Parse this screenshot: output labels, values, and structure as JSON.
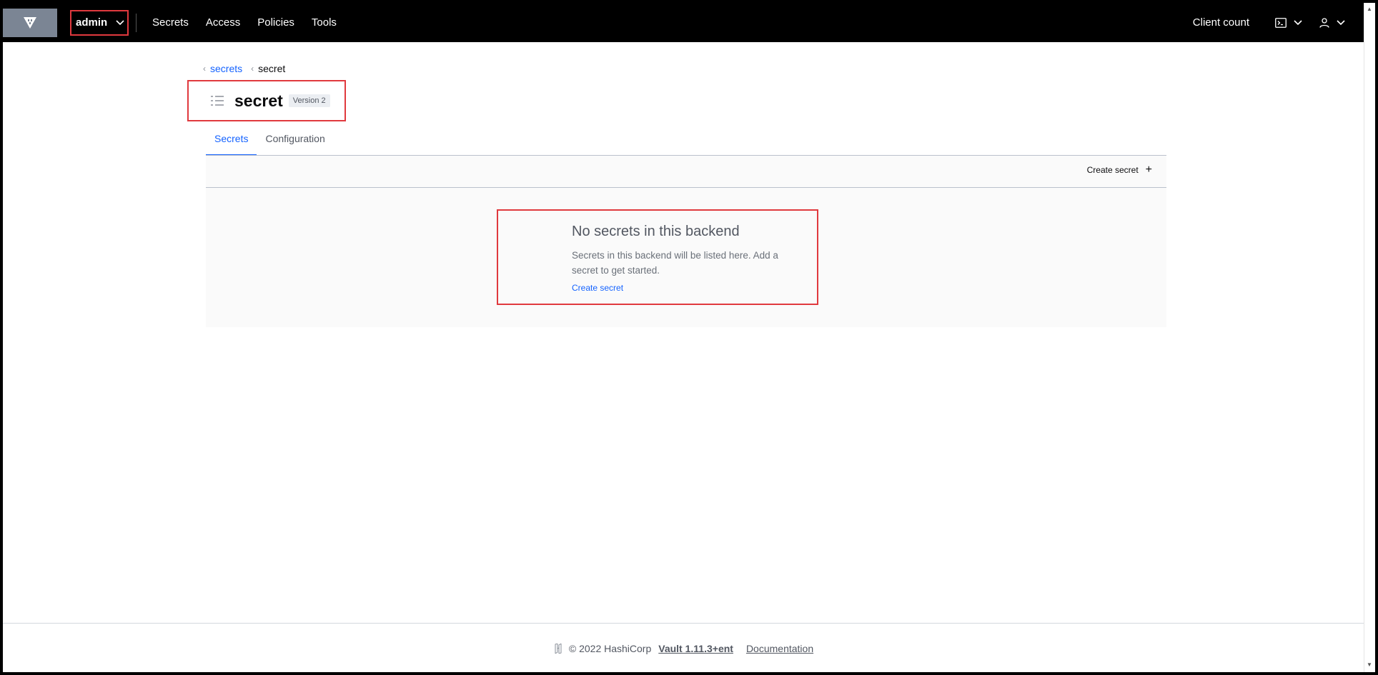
{
  "nav": {
    "namespace": "admin",
    "links": [
      "Secrets",
      "Access",
      "Policies",
      "Tools"
    ],
    "client_count": "Client count"
  },
  "breadcrumb": {
    "parent": "secrets",
    "current": "secret"
  },
  "header": {
    "title": "secret",
    "badge": "Version 2"
  },
  "tabs": {
    "secrets": "Secrets",
    "configuration": "Configuration"
  },
  "toolbar": {
    "create_label": "Create secret",
    "create_icon": "+"
  },
  "empty_state": {
    "title": "No secrets in this backend",
    "message": "Secrets in this backend will be listed here. Add a secret to get started.",
    "link": "Create secret"
  },
  "footer": {
    "copyright": "© 2022 HashiCorp",
    "version": "Vault 1.11.3+ent",
    "docs": "Documentation"
  },
  "colors": {
    "accent": "#1563ff",
    "highlight": "#e0393e",
    "nav_bg": "#000000"
  }
}
